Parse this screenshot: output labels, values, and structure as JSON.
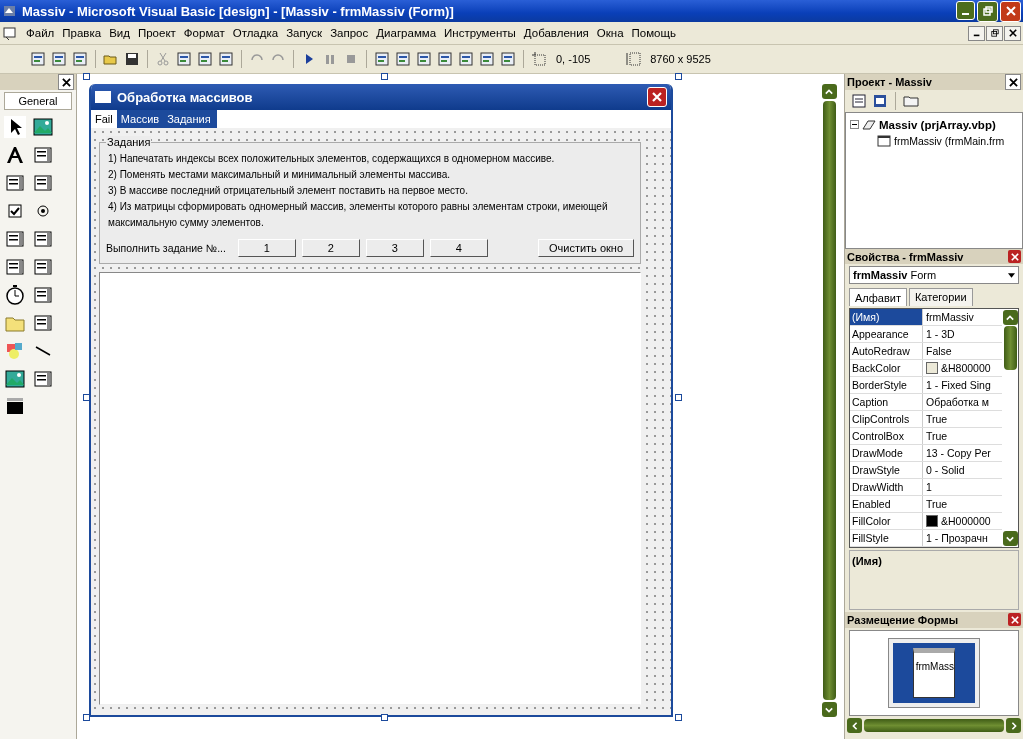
{
  "window": {
    "title": "Massiv - Microsoft Visual Basic [design] - [Massiv - frmMassiv (Form)]"
  },
  "menu": [
    "Файл",
    "Правка",
    "Вид",
    "Проект",
    "Формат",
    "Отладка",
    "Запуск",
    "Запрос",
    "Диаграмма",
    "Инструменты",
    "Добавления",
    "Окна",
    "Помощь"
  ],
  "toolbar": {
    "position": "0, -105",
    "size": "8760 x 9525"
  },
  "toolbox": {
    "title": "General"
  },
  "form": {
    "title": "Обработка массивов",
    "menu": [
      {
        "label": "Fail",
        "selected": true
      },
      {
        "label": "Массив",
        "selected": false
      },
      {
        "label": "Задания",
        "selected": false
      }
    ],
    "frame_title": "Задания",
    "tasks": [
      "1)  Напечатать индексы всех положительных элементов, содержащихся в одномерном массиве.",
      "2)  Поменять местами максимальный и минимальный элементы массива.",
      "3)  В массиве последний отрицательный элемент поставить на первое место.",
      "4)  Из матрицы сформировать одномерный массив, элементы которого равны элементам строки, имеющей максимальную сумму элементов."
    ],
    "prompt": "Выполнить задание №...",
    "task_buttons": [
      "1",
      "2",
      "3",
      "4"
    ],
    "clear_button": "Очистить окно"
  },
  "project": {
    "title": "Проект - Massiv",
    "tree": [
      {
        "label": "Massiv (prjArray.vbp)",
        "expanded": true,
        "children": [
          {
            "label": "frmMassiv (frmMain.frm"
          }
        ]
      }
    ]
  },
  "properties": {
    "title": "Свойства - frmMassiv",
    "object": "frmMassiv",
    "object_type": "Form",
    "tabs": [
      {
        "label": "Алфавит",
        "selected": true
      },
      {
        "label": "Категории",
        "selected": false
      }
    ],
    "rows": [
      {
        "name": "(Имя)",
        "value": "frmMassiv",
        "selected": true
      },
      {
        "name": "Appearance",
        "value": "1 - 3D",
        "selected": false
      },
      {
        "name": "AutoRedraw",
        "value": "False",
        "selected": false
      },
      {
        "name": "BackColor",
        "value": "&H800000",
        "selected": false,
        "color": "#ece9d8"
      },
      {
        "name": "BorderStyle",
        "value": "1 - Fixed Sing",
        "selected": false
      },
      {
        "name": "Caption",
        "value": "Обработка м",
        "selected": false
      },
      {
        "name": "ClipControls",
        "value": "True",
        "selected": false
      },
      {
        "name": "ControlBox",
        "value": "True",
        "selected": false
      },
      {
        "name": "DrawMode",
        "value": "13 - Copy Per",
        "selected": false
      },
      {
        "name": "DrawStyle",
        "value": "0 - Solid",
        "selected": false
      },
      {
        "name": "DrawWidth",
        "value": "1",
        "selected": false
      },
      {
        "name": "Enabled",
        "value": "True",
        "selected": false
      },
      {
        "name": "FillColor",
        "value": "&H000000",
        "selected": false,
        "color": "#000000"
      },
      {
        "name": "FillStyle",
        "value": "1 - Прозрачн",
        "selected": false
      }
    ],
    "description": "(Имя)"
  },
  "layout": {
    "title": "Размещение Формы",
    "form_label": "frmMass"
  }
}
